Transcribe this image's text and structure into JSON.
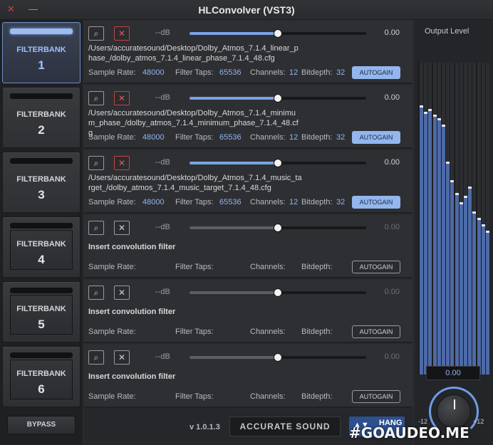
{
  "window": {
    "title": "HLConvolver (VST3)",
    "close_icon": "close-icon",
    "minimize_icon": "minimize-icon"
  },
  "filterbanks": [
    {
      "label": "FILTERBANK",
      "number": "1",
      "active": true
    },
    {
      "label": "FILTERBANK",
      "number": "2",
      "active": false
    },
    {
      "label": "FILTERBANK",
      "number": "3",
      "active": false
    },
    {
      "label": "FILTERBANK",
      "number": "4",
      "active": false
    },
    {
      "label": "FILTERBANK",
      "number": "5",
      "active": false
    },
    {
      "label": "FILTERBANK",
      "number": "6",
      "active": false
    }
  ],
  "bypass_label": "BYPASS",
  "rows": [
    {
      "db": "--dB",
      "gain": "0.00",
      "gain_level": 0.5,
      "path": "/Users/accuratesound/Desktop/Dolby_Atmos_7.1.4_linear_phase_/dolby_atmos_7.1.4_linear_phase_7.1.4_48.cfg",
      "sample_rate_label": "Sample Rate:",
      "sample_rate": "48000",
      "taps_label": "Filter Taps:",
      "taps": "65536",
      "channels_label": "Channels:",
      "channels": "12",
      "bitdepth_label": "Bitdepth:",
      "bitdepth": "32",
      "autogain": "AUTOGAIN",
      "loaded": true
    },
    {
      "db": "--dB",
      "gain": "0.00",
      "gain_level": 0.5,
      "path": "/Users/accuratesound/Desktop/Dolby_Atmos_7.1.4_minimum_phase_/dolby_atmos_7.1.4_minimum_phase_7.1.4_48.cfg",
      "sample_rate_label": "Sample Rate:",
      "sample_rate": "48000",
      "taps_label": "Filter Taps:",
      "taps": "65536",
      "channels_label": "Channels:",
      "channels": "12",
      "bitdepth_label": "Bitdepth:",
      "bitdepth": "32",
      "autogain": "AUTOGAIN",
      "loaded": true
    },
    {
      "db": "--dB",
      "gain": "0.00",
      "gain_level": 0.5,
      "path": "/Users/accuratesound/Desktop/Dolby_Atmos_7.1.4_music_target_/dolby_atmos_7.1.4_music_target_7.1.4_48.cfg",
      "sample_rate_label": "Sample Rate:",
      "sample_rate": "48000",
      "taps_label": "Filter Taps:",
      "taps": "65536",
      "channels_label": "Channels:",
      "channels": "12",
      "bitdepth_label": "Bitdepth:",
      "bitdepth": "32",
      "autogain": "AUTOGAIN",
      "loaded": true
    },
    {
      "db": "--dB",
      "gain": "0.00",
      "gain_level": 0.5,
      "path": "Insert convolution filter",
      "sample_rate_label": "Sample Rate:",
      "sample_rate": "",
      "taps_label": "Filter Taps:",
      "taps": "",
      "channels_label": "Channels:",
      "channels": "",
      "bitdepth_label": "Bitdepth:",
      "bitdepth": "",
      "autogain": "AUTOGAIN",
      "loaded": false
    },
    {
      "db": "--dB",
      "gain": "0.00",
      "gain_level": 0.5,
      "path": "Insert convolution filter",
      "sample_rate_label": "Sample Rate:",
      "sample_rate": "",
      "taps_label": "Filter Taps:",
      "taps": "",
      "channels_label": "Channels:",
      "channels": "",
      "bitdepth_label": "Bitdepth:",
      "bitdepth": "",
      "autogain": "AUTOGAIN",
      "loaded": false
    },
    {
      "db": "--dB",
      "gain": "0.00",
      "gain_level": 0.5,
      "path": "Insert convolution filter",
      "sample_rate_label": "Sample Rate:",
      "sample_rate": "",
      "taps_label": "Filter Taps:",
      "taps": "",
      "channels_label": "Channels:",
      "channels": "",
      "bitdepth_label": "Bitdepth:",
      "bitdepth": "",
      "autogain": "AUTOGAIN",
      "loaded": false
    }
  ],
  "footer": {
    "version": "v 1.0.1.3",
    "brand": "ACCURATE SOUND",
    "hang_logo": "HANG"
  },
  "output": {
    "title": "Output Level",
    "value": "0.00",
    "knob_min": "-12",
    "knob_max": "+12",
    "meter_levels": [
      0.86,
      0.84,
      0.85,
      0.83,
      0.82,
      0.8,
      0.68,
      0.62,
      0.58,
      0.55,
      0.57,
      0.6,
      0.52,
      0.5,
      0.48,
      0.46
    ]
  },
  "colors": {
    "accent": "#7aa3e6",
    "clear_armed": "#c2443c",
    "background": "#2a2b2e"
  },
  "watermark": "#GOAUDEO.ME"
}
